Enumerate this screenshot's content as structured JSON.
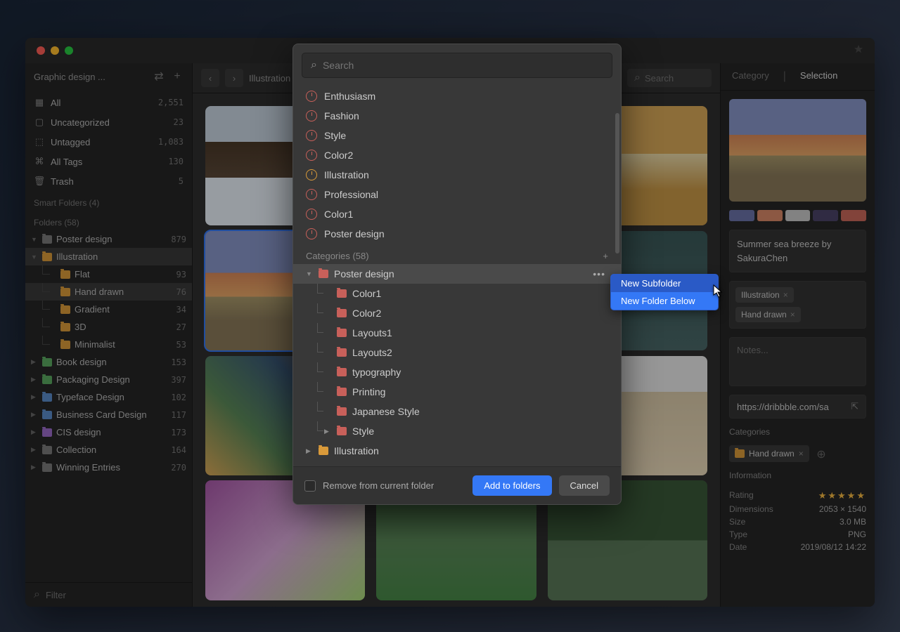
{
  "titlebar": {
    "title": ""
  },
  "sidebar": {
    "title": "Graphic design ...",
    "system_items": [
      {
        "label": "All",
        "count": "2,551"
      },
      {
        "label": "Uncategorized",
        "count": "23"
      },
      {
        "label": "Untagged",
        "count": "1,083"
      },
      {
        "label": "All Tags",
        "count": "130"
      },
      {
        "label": "Trash",
        "count": "5"
      }
    ],
    "smart_folders_label": "Smart Folders (4)",
    "folders_label": "Folders (58)",
    "folders": [
      {
        "label": "Poster design",
        "count": "879",
        "color": "gray",
        "expanded": true
      },
      {
        "label": "Illustration",
        "count": "",
        "color": "orange",
        "expanded": true,
        "selected": true
      },
      {
        "label": "Flat",
        "count": "93",
        "color": "orange",
        "child": true
      },
      {
        "label": "Hand drawn",
        "count": "76",
        "color": "orange",
        "child": true,
        "selected": true
      },
      {
        "label": "Gradient",
        "count": "34",
        "color": "orange",
        "child": true
      },
      {
        "label": "3D",
        "count": "27",
        "color": "orange",
        "child": true
      },
      {
        "label": "Minimalist",
        "count": "53",
        "color": "orange",
        "child": true
      },
      {
        "label": "Book design",
        "count": "153",
        "color": "green"
      },
      {
        "label": "Packaging Design",
        "count": "397",
        "color": "green"
      },
      {
        "label": "Typeface Design",
        "count": "102",
        "color": "blue"
      },
      {
        "label": "Business Card Design",
        "count": "117",
        "color": "blue"
      },
      {
        "label": "CIS design",
        "count": "173",
        "color": "purple"
      },
      {
        "label": "Collection",
        "count": "164",
        "color": "gray"
      },
      {
        "label": "Winning Entries",
        "count": "270",
        "color": "gray"
      }
    ],
    "filter_placeholder": "Filter"
  },
  "toolbar": {
    "breadcrumb": "Illustration",
    "search_placeholder": "Search"
  },
  "inspector": {
    "tab_category": "Category",
    "tab_selection": "Selection",
    "palette": [
      "#6a72a8",
      "#d88868",
      "#c8c8c8",
      "#4a4268",
      "#c8685a"
    ],
    "title": "Summer sea breeze by SakuraChen",
    "tags": [
      "Illustration",
      "Hand drawn"
    ],
    "notes_placeholder": "Notes...",
    "link": "https://dribbble.com/sa",
    "categories_label": "Categories",
    "category_chip": "Hand drawn",
    "info_label": "Information",
    "info": [
      {
        "k": "Rating",
        "v": "★★★★★"
      },
      {
        "k": "Dimensions",
        "v": "2053 × 1540"
      },
      {
        "k": "Size",
        "v": "3.0 MB"
      },
      {
        "k": "Type",
        "v": "PNG"
      },
      {
        "k": "Date",
        "v": "2019/08/12 14:22"
      }
    ]
  },
  "modal": {
    "search_placeholder": "Search",
    "recent": [
      {
        "label": "Enthusiasm",
        "color": "red"
      },
      {
        "label": "Fashion",
        "color": "red"
      },
      {
        "label": "Style",
        "color": "red"
      },
      {
        "label": "Color2",
        "color": "red"
      },
      {
        "label": "Illustration",
        "color": "orange"
      },
      {
        "label": "Professional",
        "color": "red"
      },
      {
        "label": "Color1",
        "color": "red"
      },
      {
        "label": "Poster design",
        "color": "red"
      }
    ],
    "categories_label": "Categories (58)",
    "categories": [
      {
        "label": "Poster design",
        "color": "red",
        "highlighted": true,
        "caret": "▼"
      },
      {
        "label": "Color1",
        "color": "red",
        "child": true
      },
      {
        "label": "Color2",
        "color": "red",
        "child": true
      },
      {
        "label": "Layouts1",
        "color": "red",
        "child": true
      },
      {
        "label": "Layouts2",
        "color": "red",
        "child": true
      },
      {
        "label": "typography",
        "color": "red",
        "child": true
      },
      {
        "label": "Printing",
        "color": "red",
        "child": true
      },
      {
        "label": "Japanese Style",
        "color": "red",
        "child": true
      },
      {
        "label": "Style",
        "color": "red",
        "child": true,
        "caret": "▶"
      },
      {
        "label": "Illustration",
        "color": "orange",
        "caret": "▶"
      }
    ],
    "remove_label": "Remove from current folder",
    "add_button": "Add to folders",
    "cancel_button": "Cancel"
  },
  "context_menu": {
    "items": [
      "New Subfolder",
      "New Folder Below"
    ]
  }
}
